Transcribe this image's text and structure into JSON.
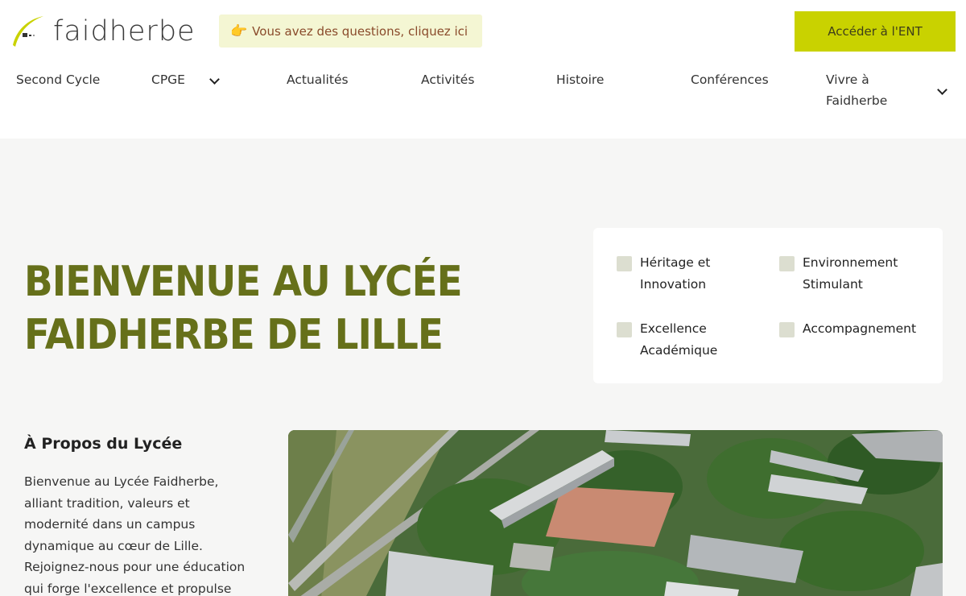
{
  "header": {
    "logo_text": "faidherbe",
    "question_banner": "Vous avez des questions, cliquez ici",
    "ent_button": "Accéder à l'ENT"
  },
  "nav": {
    "items": [
      {
        "label": "Second Cycle",
        "has_dropdown": false
      },
      {
        "label": "CPGE",
        "has_dropdown": true
      },
      {
        "label": "Actualités",
        "has_dropdown": false
      },
      {
        "label": "Activités",
        "has_dropdown": false
      },
      {
        "label": "Histoire",
        "has_dropdown": false
      },
      {
        "label": "Conférences",
        "has_dropdown": false
      },
      {
        "label": "Vivre à Faidherbe",
        "has_dropdown": true
      }
    ]
  },
  "hero": {
    "title_line1": "Bienvenue au Lycée",
    "title_line2": "Faidherbe de Lille"
  },
  "features": [
    "Héritage et Innovation",
    "Environnement Stimulant",
    "Excellence Académique",
    "Accompagnement"
  ],
  "about": {
    "title": "À Propos du Lycée",
    "text": "Bienvenue au Lycée Faidherbe, alliant tradition, valeurs et modernité dans un campus dynamique au cœur de Lille. Rejoignez-nous pour une éducation qui forge l'excellence et propulse"
  },
  "colors": {
    "accent": "#c9d200",
    "title_olive": "#66701a",
    "banner_bg": "#f4f6d3",
    "banner_text": "#8a4b2b",
    "hero_bg": "#f6f6f5"
  }
}
